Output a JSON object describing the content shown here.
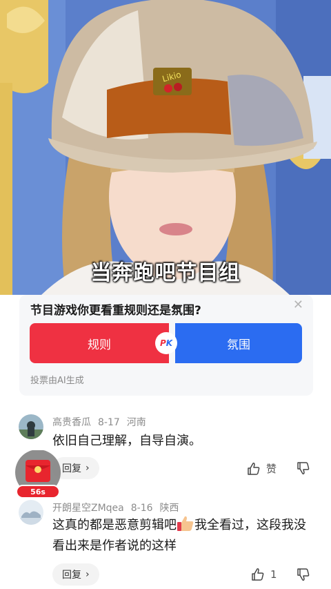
{
  "video": {
    "subtitle": "当奔跑吧节目组",
    "hat_label": "Likio"
  },
  "poll": {
    "question": "节目游戏你更看重规则还是氛围?",
    "close_icon": "close-icon",
    "option_left": "规则",
    "option_right": "氛围",
    "pk_left": "P",
    "pk_right": "K",
    "note": "投票由AI生成",
    "colors": {
      "left": "#ef3142",
      "right": "#2b6cf1"
    }
  },
  "comments": [
    {
      "user": "高贵香瓜",
      "date": "8-17",
      "location": "河南",
      "text": "依旧自己理解，自导自演。",
      "reply_label": "回复",
      "like_label": "赞"
    },
    {
      "user": "开朗星空ZMqea",
      "date": "8-16",
      "location": "陕西",
      "text_before": "这真的都是恶意剪辑吧",
      "text_after": "我全看过，这段我没看出来是作者说的这样",
      "reply_label": "回复",
      "like_count": "1"
    }
  ],
  "float_widget": {
    "timer": "56s"
  }
}
